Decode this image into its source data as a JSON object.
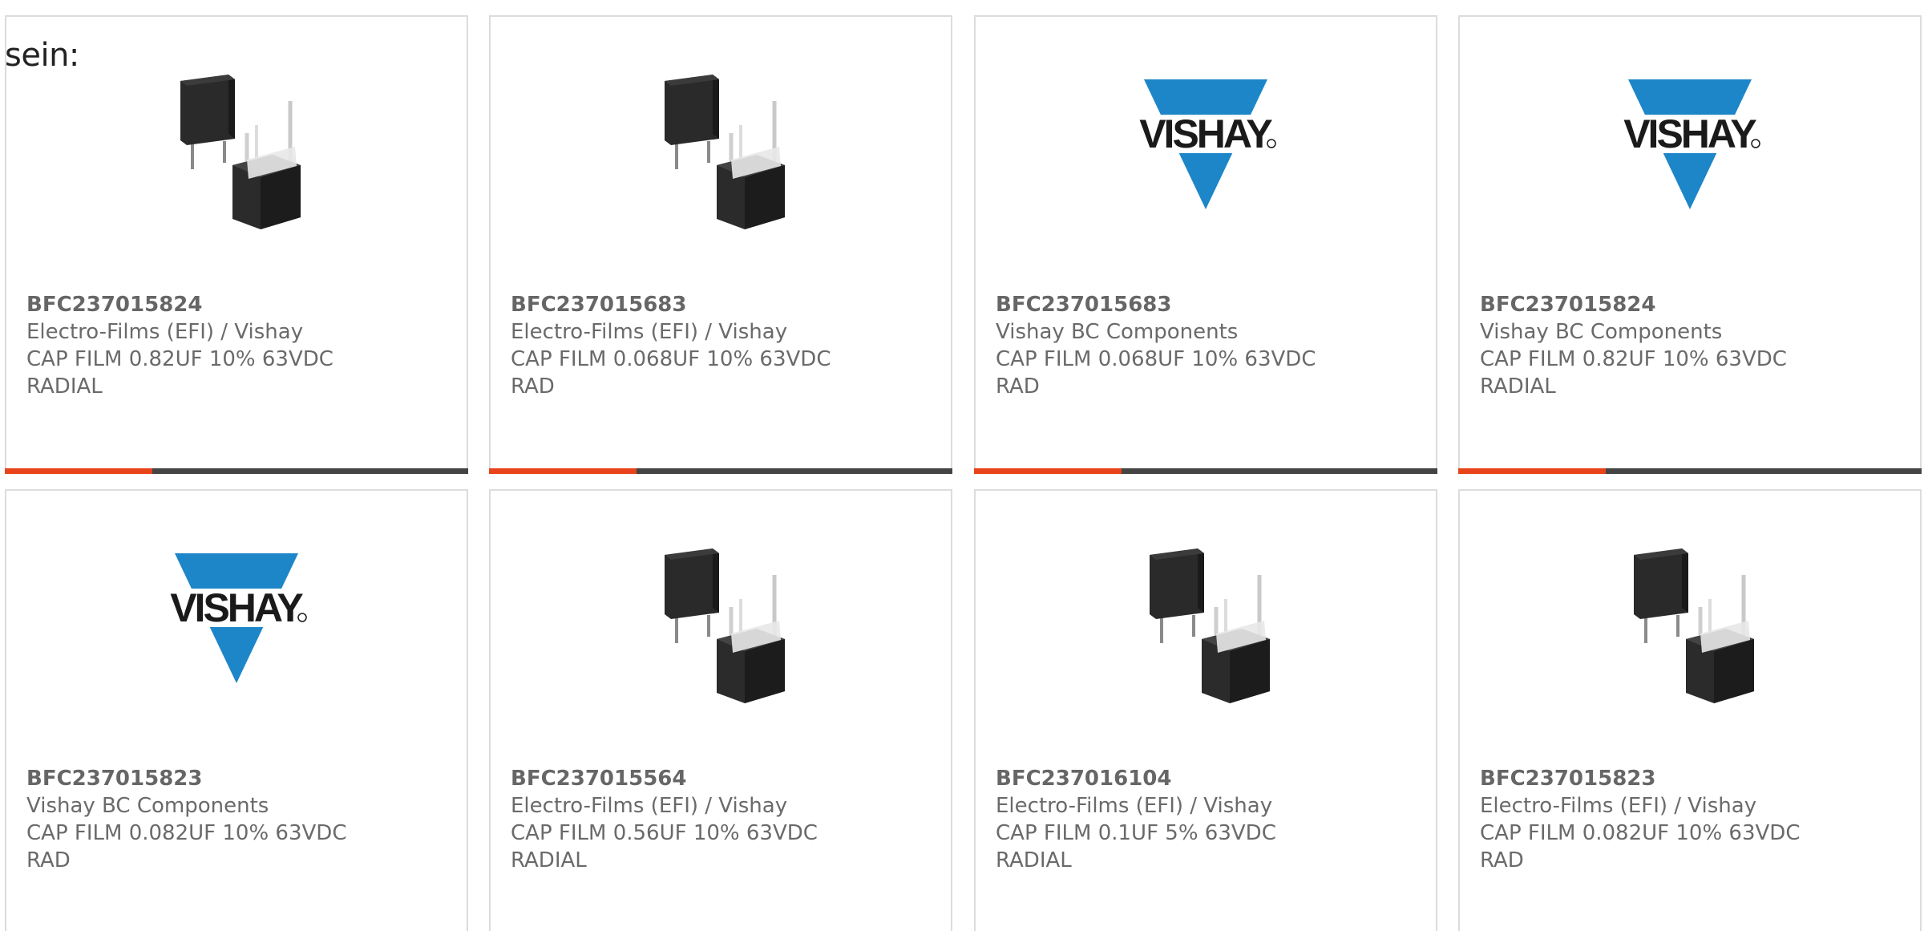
{
  "intro_text": "sein:",
  "colors": {
    "accent": "#e8431a",
    "bar": "#444444",
    "vishay_blue": "#1c86c8",
    "border": "#dcdcdc"
  },
  "cards": [
    {
      "part": "BFC237015824",
      "manufacturer": "Electro-Films (EFI) / Vishay",
      "description": "CAP FILM 0.82UF 10% 63VDC",
      "package": "RADIAL",
      "image": "capacitor-photo"
    },
    {
      "part": "BFC237015683",
      "manufacturer": "Electro-Films (EFI) / Vishay",
      "description": "CAP FILM 0.068UF 10% 63VDC",
      "package": "RAD",
      "image": "capacitor-photo"
    },
    {
      "part": "BFC237015683",
      "manufacturer": "Vishay BC Components",
      "description": "CAP FILM 0.068UF 10% 63VDC",
      "package": "RAD",
      "image": "vishay-logo"
    },
    {
      "part": "BFC237015824",
      "manufacturer": "Vishay BC Components",
      "description": "CAP FILM 0.82UF 10% 63VDC",
      "package": "RADIAL",
      "image": "vishay-logo"
    },
    {
      "part": "BFC237015823",
      "manufacturer": "Vishay BC Components",
      "description": "CAP FILM 0.082UF 10% 63VDC",
      "package": "RAD",
      "image": "vishay-logo"
    },
    {
      "part": "BFC237015564",
      "manufacturer": "Electro-Films (EFI) / Vishay",
      "description": "CAP FILM 0.56UF 10% 63VDC",
      "package": "RADIAL",
      "image": "capacitor-photo"
    },
    {
      "part": "BFC237016104",
      "manufacturer": "Electro-Films (EFI) / Vishay",
      "description": "CAP FILM 0.1UF 5% 63VDC",
      "package": "RADIAL",
      "image": "capacitor-photo"
    },
    {
      "part": "BFC237015823",
      "manufacturer": "Electro-Films (EFI) / Vishay",
      "description": "CAP FILM 0.082UF 10% 63VDC",
      "package": "RAD",
      "image": "capacitor-photo"
    }
  ]
}
